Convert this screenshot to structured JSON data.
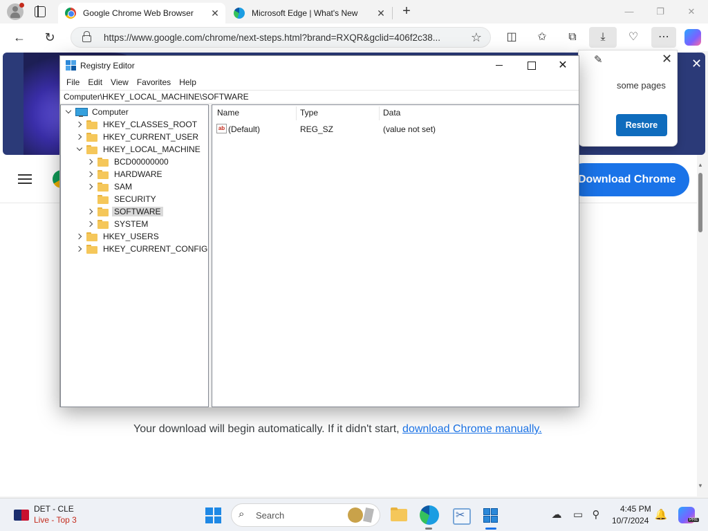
{
  "browser": {
    "tabs": [
      {
        "title": "Google Chrome Web Browser",
        "active": true
      },
      {
        "title": "Microsoft Edge | What's New",
        "active": false
      }
    ],
    "url": "https://www.google.com/chrome/next-steps.html?brand=RXQR&gclid=406f2c38...",
    "restore_popup": {
      "message": "some pages",
      "restore_label": "Restore"
    }
  },
  "page": {
    "download_chrome_label": "Download Chrome",
    "download_message": "Your download will begin automatically. If it didn't start,",
    "download_link": "download Chrome manually."
  },
  "regedit": {
    "title": "Registry Editor",
    "menu": [
      "File",
      "Edit",
      "View",
      "Favorites",
      "Help"
    ],
    "address": "Computer\\HKEY_LOCAL_MACHINE\\SOFTWARE",
    "tree": {
      "root": "Computer",
      "hives": [
        {
          "label": "HKEY_CLASSES_ROOT",
          "expanded": false
        },
        {
          "label": "HKEY_CURRENT_USER",
          "expanded": false
        },
        {
          "label": "HKEY_LOCAL_MACHINE",
          "expanded": true
        },
        {
          "label": "HKEY_USERS",
          "expanded": false
        },
        {
          "label": "HKEY_CURRENT_CONFIG",
          "expanded": false
        }
      ],
      "hklm_children": [
        {
          "label": "BCD00000000",
          "expandable": true
        },
        {
          "label": "HARDWARE",
          "expandable": true
        },
        {
          "label": "SAM",
          "expandable": true
        },
        {
          "label": "SECURITY",
          "expandable": false
        },
        {
          "label": "SOFTWARE",
          "expandable": true,
          "selected": true
        },
        {
          "label": "SYSTEM",
          "expandable": true
        }
      ]
    },
    "columns": {
      "name": "Name",
      "type": "Type",
      "data": "Data"
    },
    "values": [
      {
        "icon": "ab",
        "name": "(Default)",
        "type": "REG_SZ",
        "data": "(value not set)"
      }
    ]
  },
  "taskbar": {
    "weather_line1": "DET - CLE",
    "weather_line2": "Live - Top 3",
    "search_placeholder": "Search",
    "time": "4:45 PM",
    "date": "10/7/2024",
    "copilot_badge": "PRE"
  },
  "colors": {
    "accent": "#1a73e8",
    "restore_button": "#0f6cbd",
    "taskbar": "#eef1f6",
    "selection": "#d9d9d9",
    "folder": "#f5c75a"
  }
}
